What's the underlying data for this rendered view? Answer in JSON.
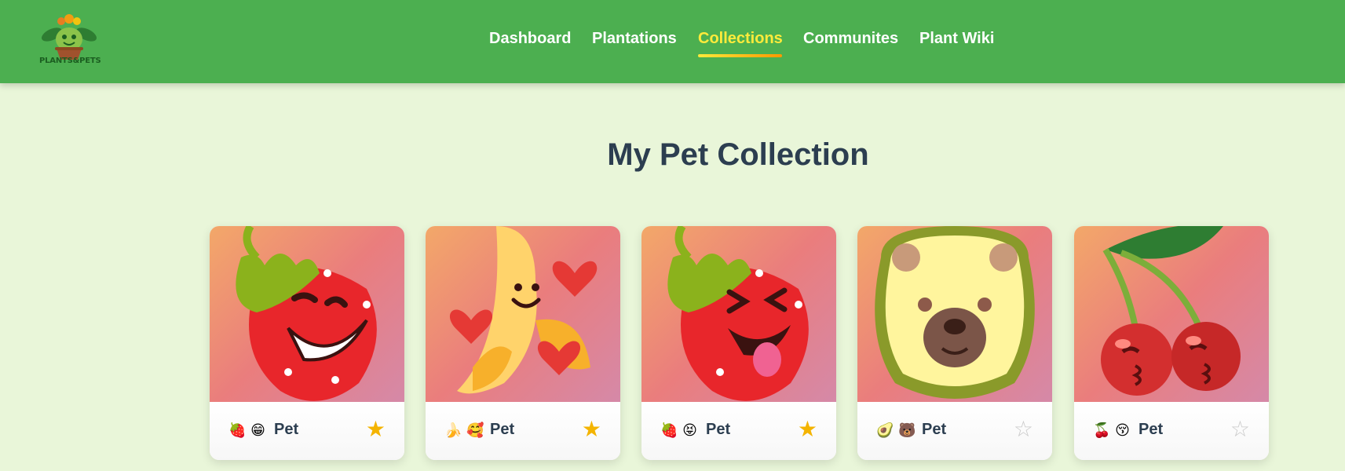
{
  "brand": {
    "logo_text": "PLANTS&PETS"
  },
  "nav": {
    "items": [
      {
        "label": "Dashboard",
        "active": false
      },
      {
        "label": "Plantations",
        "active": false
      },
      {
        "label": "Collections",
        "active": true
      },
      {
        "label": "Communites",
        "active": false
      },
      {
        "label": "Plant Wiki",
        "active": false
      }
    ]
  },
  "main": {
    "title": "My Pet Collection"
  },
  "cards": [
    {
      "art": "strawberry-grin",
      "emojis": "🍓 😁",
      "name": "Pet",
      "favorite": true,
      "star": "★"
    },
    {
      "art": "banana-hearts",
      "emojis": "🍌 🥰",
      "name": "Pet",
      "favorite": true,
      "star": "★"
    },
    {
      "art": "strawberry-tongue",
      "emojis": "🍓 😝",
      "name": "Pet",
      "favorite": true,
      "star": "★"
    },
    {
      "art": "avocado-bear",
      "emojis": "🥑 🐻",
      "name": "Pet",
      "favorite": false,
      "star": "☆"
    },
    {
      "art": "cherry-kiss",
      "emojis": "🍒 😚",
      "name": "Pet",
      "favorite": false,
      "star": "☆"
    }
  ],
  "colors": {
    "header_bg": "#4caf50",
    "page_bg": "#e9f6d9",
    "active_nav": "#ffeb3b",
    "title": "#2c3e50",
    "star_fav": "#f4b400",
    "star_off": "#c9c9c9"
  }
}
